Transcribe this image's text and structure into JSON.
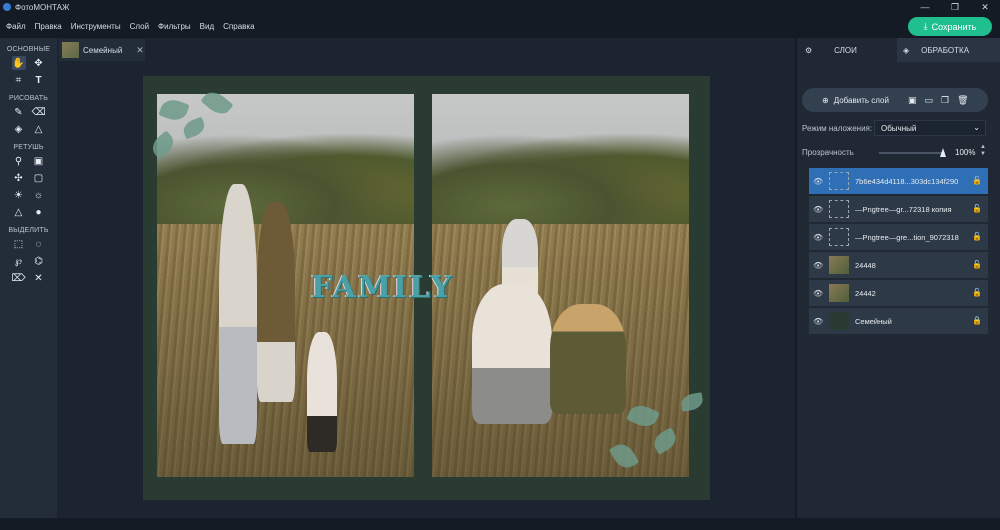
{
  "app": {
    "title": "ФотоМОНТАЖ"
  },
  "window_controls": {
    "minimize": "—",
    "maximize": "❐",
    "close": "✕"
  },
  "menu": [
    "Файл",
    "Правка",
    "Инструменты",
    "Слой",
    "Фильтры",
    "Вид",
    "Справка"
  ],
  "save_button": {
    "label": "Сохранить",
    "icon": "download-icon",
    "color": "#1fbf8f"
  },
  "toolbox": {
    "sections": [
      {
        "title": "ОСНОВНЫЕ",
        "tools": [
          [
            "hand-icon",
            "move-icon"
          ],
          [
            "crop-icon",
            "text-icon"
          ]
        ]
      },
      {
        "title": "РИСОВАТЬ",
        "tools": [
          [
            "brush-icon",
            "eraser-icon"
          ],
          [
            "fill-icon",
            "shapes-icon"
          ]
        ]
      },
      {
        "title": "РЕТУШЬ",
        "tools": [
          [
            "stamp-icon",
            "patch-icon"
          ],
          [
            "heal-icon",
            "frame-icon"
          ],
          [
            "brightness-icon",
            "darken-icon"
          ],
          [
            "sharpen-icon",
            "blur-icon"
          ]
        ]
      },
      {
        "title": "ВЫДЕЛИТЬ",
        "tools": [
          [
            "rect-select-icon",
            "ellipse-select-icon"
          ],
          [
            "lasso-icon",
            "polygon-lasso-icon"
          ],
          [
            "magnetic-lasso-icon",
            "magic-wand-icon"
          ]
        ]
      }
    ]
  },
  "document_tab": {
    "name": "Семейный",
    "close": "✕"
  },
  "canvas": {
    "overlay_text": "FAMILY"
  },
  "right_panel": {
    "tabs": [
      {
        "label": "СЛОИ",
        "icon": "sliders-icon",
        "active": true
      },
      {
        "label": "ОБРАБОТКА",
        "icon": "layers-icon",
        "active": false
      }
    ],
    "add_layer_label": "Добавить слой",
    "blend_label": "Режим наложения:",
    "blend_value": "Обычный",
    "opacity_label": "Прозрачность",
    "opacity_value": "100%",
    "layers": [
      {
        "name": "7b6e434d4118...303dc134f290",
        "selected": true,
        "thumb": "dashed",
        "locked": false
      },
      {
        "name": "—Pngtree—gr...72318 копия",
        "selected": false,
        "thumb": "dashed",
        "locked": false
      },
      {
        "name": "—Pngtree—gre...tion_9072318",
        "selected": false,
        "thumb": "dashed",
        "locked": false
      },
      {
        "name": "24448",
        "selected": false,
        "thumb": "photo",
        "locked": false
      },
      {
        "name": "24442",
        "selected": false,
        "thumb": "photo",
        "locked": false
      },
      {
        "name": "Семейный",
        "selected": false,
        "thumb": "bg",
        "locked": true
      }
    ]
  }
}
